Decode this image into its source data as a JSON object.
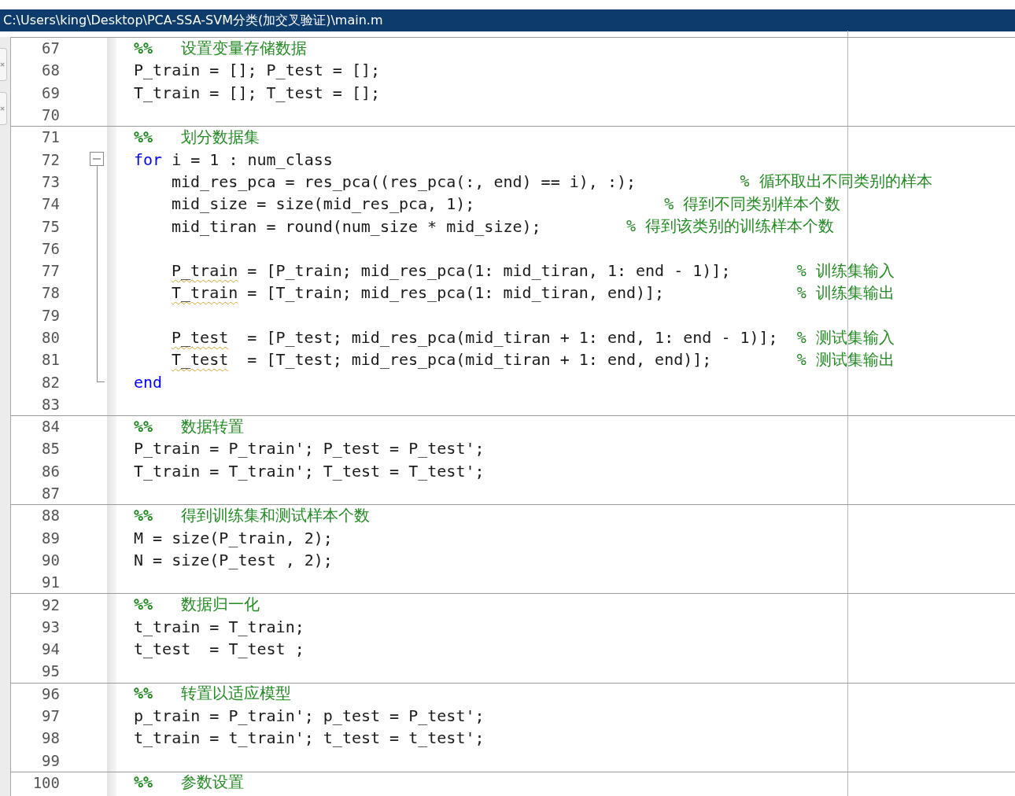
{
  "window": {
    "title": "C:\\Users\\king\\Desktop\\PCA-SSA-SVM分类(加交叉验证)\\main.m"
  },
  "lines": [
    {
      "number": "67",
      "section_start": true,
      "segments": [
        {
          "kind": "section_mark",
          "text": "%%   "
        },
        {
          "kind": "section_title",
          "text": "设置变量存储数据"
        }
      ]
    },
    {
      "number": "68",
      "segments": [
        {
          "kind": "code",
          "text": "P_train = []; P_test = [];"
        }
      ]
    },
    {
      "number": "69",
      "segments": [
        {
          "kind": "code",
          "text": "T_train = []; T_test = [];"
        }
      ]
    },
    {
      "number": "70"
    },
    {
      "number": "71",
      "section_start": true,
      "segments": [
        {
          "kind": "section_mark",
          "text": "%%   "
        },
        {
          "kind": "section_title",
          "text": "划分数据集"
        }
      ]
    },
    {
      "number": "72",
      "fold_start": true,
      "segments": [
        {
          "kind": "keyword",
          "text": "for"
        },
        {
          "kind": "code",
          "text": " i = 1 : num_class"
        }
      ]
    },
    {
      "number": "73",
      "in_fold": true,
      "segments": [
        {
          "kind": "code",
          "text": "mid_res_pca = res_pca((res_pca(:, end) == i), :);           "
        }
      ],
      "comment": "% 循环取出不同类别的样本"
    },
    {
      "number": "74",
      "in_fold": true,
      "segments": [
        {
          "kind": "code",
          "text": "mid_size = size(mid_res_pca, 1);                    "
        }
      ],
      "comment": "% 得到不同类别样本个数"
    },
    {
      "number": "75",
      "in_fold": true,
      "segments": [
        {
          "kind": "code",
          "text": "mid_tiran = round(num_size * mid_size);         "
        }
      ],
      "comment": "% 得到该类别的训练样本个数"
    },
    {
      "number": "76",
      "in_fold": true
    },
    {
      "number": "77",
      "in_fold": true,
      "segments": [
        {
          "kind": "warning",
          "text": "P_train"
        },
        {
          "kind": "code",
          "text": " = [P_train; mid_res_pca(1: mid_tiran, 1: end - 1)];       "
        }
      ],
      "comment": "% 训练集输入"
    },
    {
      "number": "78",
      "in_fold": true,
      "segments": [
        {
          "kind": "warning",
          "text": "T_train"
        },
        {
          "kind": "code",
          "text": " = [T_train; mid_res_pca(1: mid_tiran, end)];              "
        }
      ],
      "comment": "% 训练集输出"
    },
    {
      "number": "79",
      "in_fold": true
    },
    {
      "number": "80",
      "in_fold": true,
      "segments": [
        {
          "kind": "warning",
          "text": "P_test"
        },
        {
          "kind": "code",
          "text": "  = [P_test; mid_res_pca(mid_tiran + 1: end, 1: end - 1)];  "
        }
      ],
      "comment": "% 测试集输入"
    },
    {
      "number": "81",
      "in_fold": true,
      "segments": [
        {
          "kind": "warning",
          "text": "T_test"
        },
        {
          "kind": "code",
          "text": "  = [T_test; mid_res_pca(mid_tiran + 1: end, end)];         "
        }
      ],
      "comment": "% 测试集输出"
    },
    {
      "number": "82",
      "fold_end": true,
      "segments": [
        {
          "kind": "keyword",
          "text": "end"
        }
      ]
    },
    {
      "number": "83"
    },
    {
      "number": "84",
      "section_start": true,
      "segments": [
        {
          "kind": "section_mark",
          "text": "%%   "
        },
        {
          "kind": "section_title",
          "text": "数据转置"
        }
      ]
    },
    {
      "number": "85",
      "segments": [
        {
          "kind": "code",
          "text": "P_train = P_train'; P_test = P_test';"
        }
      ]
    },
    {
      "number": "86",
      "segments": [
        {
          "kind": "code",
          "text": "T_train = T_train'; T_test = T_test';"
        }
      ]
    },
    {
      "number": "87"
    },
    {
      "number": "88",
      "section_start": true,
      "segments": [
        {
          "kind": "section_mark",
          "text": "%%   "
        },
        {
          "kind": "section_title",
          "text": "得到训练集和测试样本个数"
        }
      ]
    },
    {
      "number": "89",
      "segments": [
        {
          "kind": "code",
          "text": "M = size(P_train, 2);"
        }
      ]
    },
    {
      "number": "90",
      "segments": [
        {
          "kind": "code",
          "text": "N = size(P_test , 2);"
        }
      ]
    },
    {
      "number": "91"
    },
    {
      "number": "92",
      "section_start": true,
      "segments": [
        {
          "kind": "section_mark",
          "text": "%%   "
        },
        {
          "kind": "section_title",
          "text": "数据归一化"
        }
      ]
    },
    {
      "number": "93",
      "segments": [
        {
          "kind": "code",
          "text": "t_train = T_train;"
        }
      ]
    },
    {
      "number": "94",
      "segments": [
        {
          "kind": "code",
          "text": "t_test  = T_test ;"
        }
      ]
    },
    {
      "number": "95"
    },
    {
      "number": "96",
      "section_start": true,
      "segments": [
        {
          "kind": "section_mark",
          "text": "%%   "
        },
        {
          "kind": "section_title",
          "text": "转置以适应模型"
        }
      ]
    },
    {
      "number": "97",
      "segments": [
        {
          "kind": "code",
          "text": "p_train = P_train'; p_test = P_test';"
        }
      ]
    },
    {
      "number": "98",
      "segments": [
        {
          "kind": "code",
          "text": "t_train = t_train'; t_test = t_test';"
        }
      ]
    },
    {
      "number": "99"
    },
    {
      "number": "100",
      "section_start": true,
      "segments": [
        {
          "kind": "section_mark",
          "text": "%%   "
        },
        {
          "kind": "section_title",
          "text": "参数设置"
        }
      ]
    }
  ]
}
